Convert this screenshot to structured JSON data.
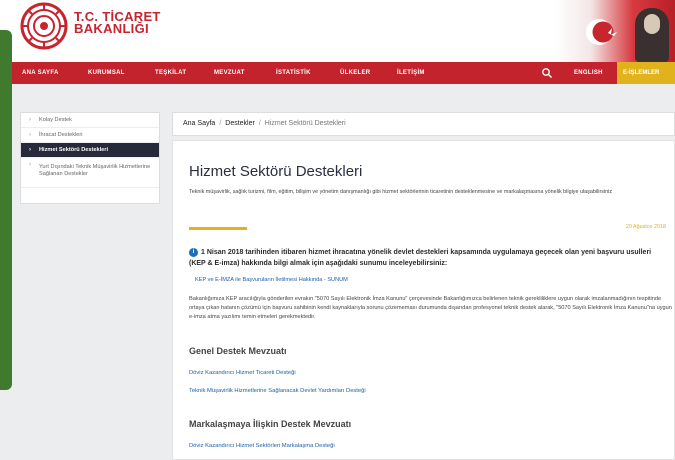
{
  "brand": {
    "line1": "T.C. TİCARET",
    "line2": "BAKANLIĞI",
    "logo_icon": "ministry-seal-icon"
  },
  "colors": {
    "brand_red": "#c3232c",
    "gold": "#e0b21b",
    "navy": "#262a3b",
    "link_blue": "#1c5fa8"
  },
  "nav": {
    "items": [
      "ANA SAYFA",
      "KURUMSAL",
      "TEŞKİLAT",
      "MEVZUAT",
      "İSTATİSTİK",
      "ÜLKELER",
      "İLETİŞİM"
    ],
    "english": "ENGLISH",
    "eislemler": "E-İŞLEMLER",
    "search_icon": "search-icon"
  },
  "sidebar": {
    "items": [
      {
        "label": "Kolay Destek",
        "active": false
      },
      {
        "label": "İhracat Destekleri",
        "active": false
      },
      {
        "label": "Hizmet Sektörü Destekleri",
        "active": true
      },
      {
        "label": "Yurt Dışındaki Teknik Müşavirlik Hizmetlerine Sağlanan Destekler",
        "active": false
      }
    ]
  },
  "breadcrumb": {
    "home": "Ana Sayfa",
    "section": "Destekler",
    "current": "Hizmet Sektörü Destekleri"
  },
  "main": {
    "title": "Hizmet Sektörü Destekleri",
    "subtitle": "Teknik müşavirlik, sağlık turizmi, film, eğitim, bilişim ve yönetim danışmanlığı gibi hizmet sektörlerinin ticaretinin desteklenmesine ve markalaşmasına yönelik bilgiye ulaşabilirsiniz",
    "date": "20 Ağustos 2018",
    "notice": "1 Nisan 2018 tarihinden itibaren hizmet ihracatına yönelik devlet destekleri kapsamında uygulamaya geçecek olan yeni başvuru usulleri (KEP & E-imza) hakkında bilgi almak için aşağıdaki sunumu inceleyebilirsiniz:",
    "kep_link": "KEP ve E-İMZA ile Başvuruların İletilmesi Hakkında - SUNUM",
    "paragraph": "Bakanlığımıza KEP aracılığıyla gönderilen evrakın \"5070 Sayılı Elektronik İmza Kanunu\" çerçevesinde Bakanlığımızca belirlenen teknik gerekliliklere uygun olarak imzalanmadığının tespitinde ortaya çıkan hatanın çözümü için başvuru sahibinin kendi kaynaklarıyla sorunu çözememası durumunda dışarıdan profesyonel teknik destek alarak, \"5070 Sayılı Elektronik İmza Kanunu\"na uygun e-imza atma yazılımı temin etmeleri gerekmektedir.",
    "genel_heading": "Genel Destek Mevzuatı",
    "genel_links": [
      "Döviz Kazandırıcı Hizmet Ticareti Desteği",
      "Teknik Müşavirlik Hizmetlerine Sağlanacak Devlet Yardımları Desteği"
    ],
    "mark_heading": "Markalaşmaya İlişkin Destek Mevzuatı",
    "mark_links": [
      "Döviz Kazandırıcı Hizmet Sektörleri Markalaşma Desteği"
    ]
  }
}
